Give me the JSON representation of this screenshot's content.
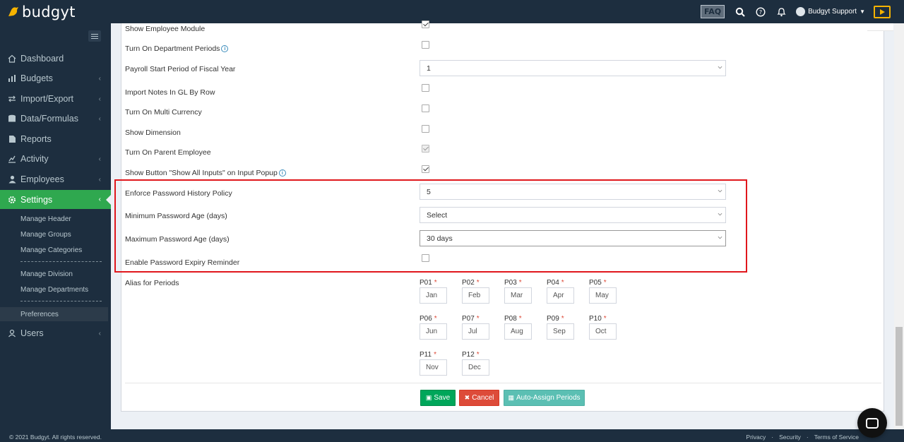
{
  "brand": {
    "name": "budgyt",
    "accent": "#f5b300"
  },
  "topbar": {
    "faq_label": "FAQ",
    "user_name": "Budgyt Support"
  },
  "sidebar": {
    "items": [
      {
        "label": "Dashboard",
        "icon": "home-icon"
      },
      {
        "label": "Budgets",
        "icon": "bar-chart-icon"
      },
      {
        "label": "Import/Export",
        "icon": "exchange-icon"
      },
      {
        "label": "Data/Formulas",
        "icon": "database-icon"
      },
      {
        "label": "Reports",
        "icon": "file-icon"
      },
      {
        "label": "Activity",
        "icon": "activity-icon"
      },
      {
        "label": "Employees",
        "icon": "user-icon"
      },
      {
        "label": "Settings",
        "icon": "gear-icon",
        "active": true
      },
      {
        "label": "Users",
        "icon": "users-icon"
      }
    ],
    "settings_sub": [
      {
        "label": "Manage Header"
      },
      {
        "label": "Manage Groups"
      },
      {
        "label": "Manage Categories"
      },
      {
        "label": "Manage Division"
      },
      {
        "label": "Manage Departments"
      },
      {
        "label": "Preferences",
        "current": true
      }
    ],
    "footer": "© 2021 Budgyt. All rights reserved."
  },
  "preferences": {
    "show_employee_module": {
      "label": "Show Employee Module",
      "checked": true
    },
    "dept_periods": {
      "label": "Turn On Department Periods",
      "checked": false
    },
    "payroll_start": {
      "label": "Payroll Start Period of Fiscal Year",
      "value": "1"
    },
    "import_notes": {
      "label": "Import Notes In GL By Row",
      "checked": false
    },
    "multi_currency": {
      "label": "Turn On Multi Currency",
      "checked": false
    },
    "show_dimension": {
      "label": "Show Dimension",
      "checked": false
    },
    "parent_employee": {
      "label": "Turn On Parent Employee",
      "checked": true,
      "disabled": true
    },
    "show_all_inputs": {
      "label": "Show Button \"Show All Inputs\" on Input Popup",
      "checked": true
    },
    "password_history": {
      "label": "Enforce Password History Policy",
      "value": "5"
    },
    "min_password_age": {
      "label": "Minimum Password Age (days)",
      "value": "Select"
    },
    "max_password_age": {
      "label": "Maximum Password Age (days)",
      "value": "30 days"
    },
    "expiry_reminder": {
      "label": "Enable Password Expiry Reminder",
      "checked": false
    },
    "alias_label": "Alias for Periods",
    "periods": [
      {
        "code": "P01",
        "alias": "Jan"
      },
      {
        "code": "P02",
        "alias": "Feb"
      },
      {
        "code": "P03",
        "alias": "Mar"
      },
      {
        "code": "P04",
        "alias": "Apr"
      },
      {
        "code": "P05",
        "alias": "May"
      },
      {
        "code": "P06",
        "alias": "Jun"
      },
      {
        "code": "P07",
        "alias": "Jul"
      },
      {
        "code": "P08",
        "alias": "Aug"
      },
      {
        "code": "P09",
        "alias": "Sep"
      },
      {
        "code": "P10",
        "alias": "Oct"
      },
      {
        "code": "P11",
        "alias": "Nov"
      },
      {
        "code": "P12",
        "alias": "Dec"
      }
    ],
    "required_mark": "*"
  },
  "actions": {
    "save": "Save",
    "cancel": "Cancel",
    "auto_assign": "Auto-Assign Periods"
  },
  "footer_links": [
    "Privacy",
    "Security",
    "Terms of Service"
  ],
  "colors": {
    "highlight_border": "#e0171c",
    "sidebar_bg": "#1d2e3f",
    "active_green": "#2fa84f"
  }
}
